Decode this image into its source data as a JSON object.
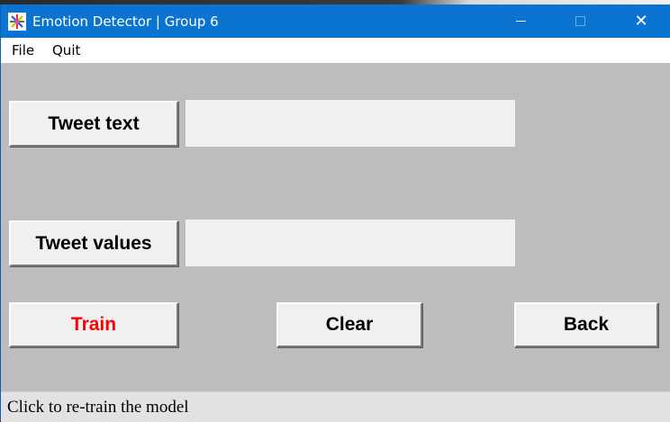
{
  "window": {
    "title": "Emotion Detector | Group 6",
    "titlebar_color": "#0b74d1",
    "body_color": "#bdbdbd",
    "controls": {
      "minimize_icon": "minimize-icon",
      "maximize_icon": "maximize-icon",
      "close_icon": "close-icon",
      "close_glyph": "✕"
    }
  },
  "menu": {
    "file": "File",
    "quit": "Quit"
  },
  "form": {
    "tweet_text_button": "Tweet text",
    "tweet_text_value": "",
    "tweet_values_button": "Tweet values",
    "tweet_values_value": ""
  },
  "actions": {
    "train": "Train",
    "train_color": "#ff0000",
    "clear": "Clear",
    "back": "Back"
  },
  "status": {
    "text": "Click to re-train the model"
  }
}
